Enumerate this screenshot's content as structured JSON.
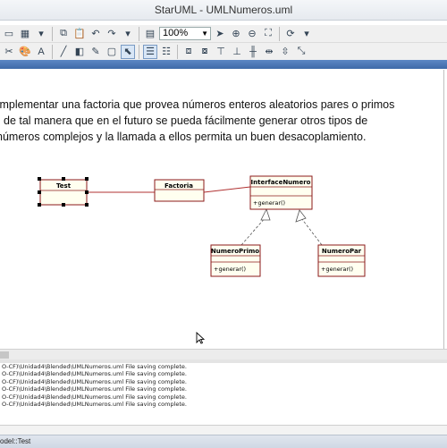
{
  "window": {
    "title": "StarUML - UMLNumeros.uml"
  },
  "toolbar": {
    "zoom_value": "100%",
    "row1_icons": [
      "diagram-icon",
      "grid-icon",
      "chevron-down-icon",
      "copy-icon",
      "paste-icon",
      "undo-icon",
      "redo-icon",
      "chevron-down-icon",
      "zoom-in-icon",
      "zoom-out-icon",
      "fit-icon",
      "refresh-icon",
      "chevron-down-icon"
    ],
    "row2_icons": [
      "cut-icon",
      "color-icon",
      "font-icon",
      "line-style-icon",
      "arrow-icon",
      "select-icon",
      "hand-icon",
      "align-left-icon",
      "align-right-icon",
      "order-front-icon",
      "order-back-icon",
      "align-top-icon",
      "align-bottom-icon",
      "align-center-icon",
      "distribute-icon",
      "distribute-v-icon",
      "resize-icon"
    ]
  },
  "description": {
    "lines": [
      "Implementar una factoria que provea números enteros aleatorios pares o primos",
      "de tal manera que en el futuro se pueda fácilmente generar otros tipos de",
      "números complejos y la llamada a ellos permita un buen desacoplamiento."
    ]
  },
  "diagram": {
    "classes": {
      "test": {
        "name": "Test"
      },
      "factoria": {
        "name": "Factoria"
      },
      "interface": {
        "name": "InterfaceNumero",
        "operation": "+generar()"
      },
      "primo": {
        "name": "NumeroPrimo",
        "operation": "+generar()"
      },
      "par": {
        "name": "NumeroPar",
        "operation": "+generar()"
      }
    },
    "colors": {
      "class_fill": "#fffff0",
      "class_border": "#8b1a1a",
      "association": "#b03030"
    }
  },
  "output": {
    "lines": [
      "O-CF)\\Unidad4\\Blended\\UMLNumeros.uml File saving complete.",
      "O-CF)\\Unidad4\\Blended\\UMLNumeros.uml File saving complete.",
      "O-CF)\\Unidad4\\Blended\\UMLNumeros.uml File saving complete.",
      "O-CF)\\Unidad4\\Blended\\UMLNumeros.uml File saving complete.",
      "O-CF)\\Unidad4\\Blended\\UMLNumeros.uml File saving complete.",
      "O-CF)\\Unidad4\\Blended\\UMLNumeros.uml File saving complete."
    ]
  },
  "status": {
    "text": "odel::Test"
  }
}
